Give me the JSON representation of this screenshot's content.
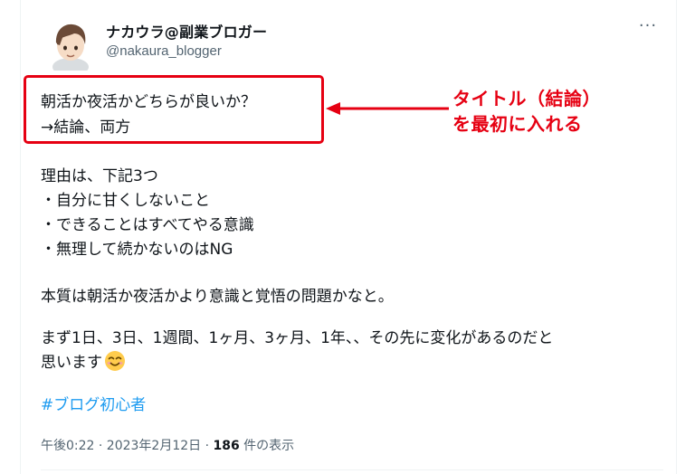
{
  "author": {
    "name": "ナカウラ@副業ブロガー",
    "handle": "@nakaura_blogger",
    "more_label": "···"
  },
  "tweet": {
    "lines": [
      "朝活か夜活かどちらが良いか？",
      "→結論、両方",
      "理由は、下記3つ",
      "・自分に甘くしないこと",
      "・できることはすべてやる意識",
      "・無理して続かないのはNG",
      "本質は朝活か夜活かより意識と覚悟の問題かなと。",
      "まず1日、3日、1週間、1ヶ月、3ヶ月、1年、、その先に変化があるのだと",
      "思います"
    ],
    "emoji": "smiling-face-icon",
    "hashtag": "#ブログ初心者"
  },
  "meta": {
    "time_date": "午後0:22 · 2023年2月12日 · ",
    "views_count": "186",
    "views_label": " 件の表示"
  },
  "annotation": {
    "line1": "タイトル（結論）",
    "line2": "を最初に入れる",
    "color": "#e60012"
  },
  "colors": {
    "text": "#0f1419",
    "secondary": "#536471",
    "link": "#1d9bf0",
    "highlight": "#e60012"
  }
}
